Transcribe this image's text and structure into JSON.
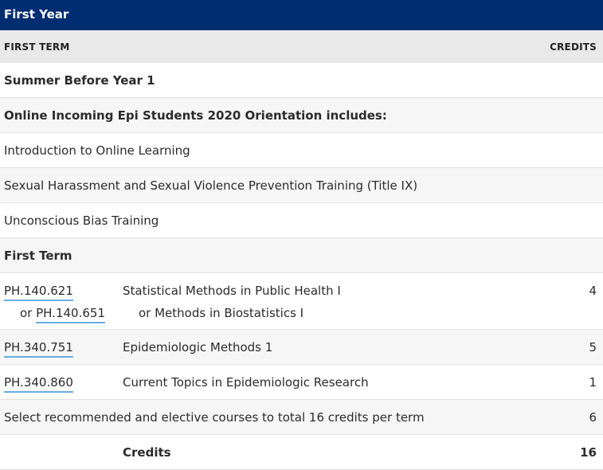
{
  "year_title": "First Year",
  "columns": {
    "term": "FIRST TERM",
    "credits": "CREDITS"
  },
  "rows": {
    "summer": "Summer Before Year 1",
    "orientation": "Online Incoming Epi Students 2020 Orientation includes:",
    "item1": "Introduction to Online Learning",
    "item2": "Sexual Harassment and Sexual Violence Prevention Training (Title IX)",
    "item3": "Unconscious Bias Training",
    "first_term": "First Term"
  },
  "courses": [
    {
      "code": "PH.140.621",
      "title": "Statistical Methods in Public Health I",
      "alt_prefix": "or ",
      "alt_code": "PH.140.651",
      "alt_title": "or Methods in Biostatistics I",
      "credits": "4"
    },
    {
      "code": "PH.340.751",
      "title": "Epidemiologic Methods 1",
      "credits": "5"
    },
    {
      "code": "PH.340.860",
      "title": "Current Topics in Epidemiologic Research",
      "credits": "1"
    }
  ],
  "elective": {
    "text": "Select recommended and elective courses to total 16 credits per term",
    "credits": "6"
  },
  "total": {
    "label": "Credits",
    "value": "16"
  }
}
